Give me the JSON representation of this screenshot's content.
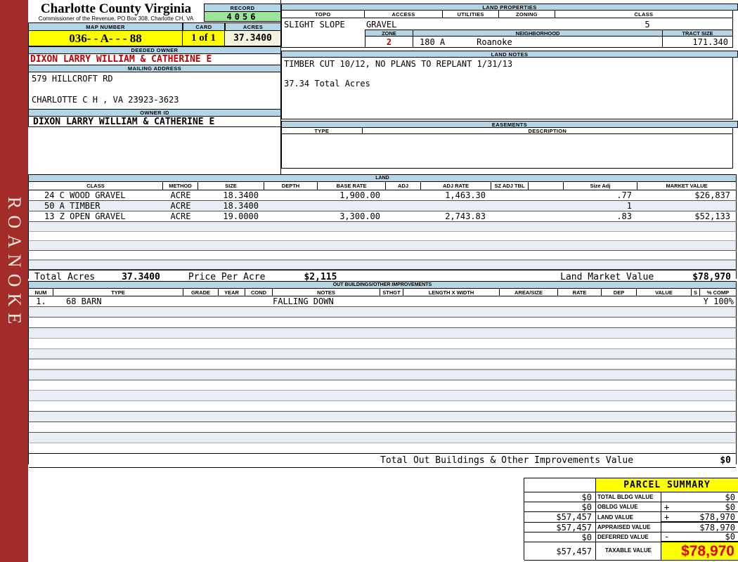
{
  "sidebar": {
    "label": "ROANOKE"
  },
  "header": {
    "county": "Charlotte County Virginia",
    "commissioner": "Commissioner of the Revenue, PO Box 308, Charlotte CH, VA",
    "record_label": "RECORD",
    "record_value": "4056",
    "map_label": "MAP NUMBER",
    "map_value": "036- - A- - - 88",
    "card_label": "CARD",
    "card_value": "1 of 1",
    "acres_label": "ACRES",
    "acres_value": "37.3400"
  },
  "owner": {
    "deeded_label": "DEEDED OWNER",
    "deeded_value": "DIXON LARRY WILLIAM & CATHERINE E",
    "mailing_label": "MAILING ADDRESS",
    "address_line1": "579 HILLCROFT RD",
    "address_line2": "CHARLOTTE C H , VA 23923-3623",
    "owner_id_label": "OWNER ID",
    "owner_id_value": "DIXON LARRY WILLIAM & CATHERINE E"
  },
  "land_properties": {
    "title": "LAND PROPERTIES",
    "headers": {
      "topo": "TOPO",
      "access": "ACCESS",
      "utilities": "UTILITIES",
      "zoning": "ZONING",
      "class": "CLASS"
    },
    "values": {
      "topo": "SLIGHT SLOPE",
      "access": "GRAVEL",
      "class": "5"
    },
    "zone_label": "ZONE",
    "zone_value": "2",
    "neighborhood_label": "NEIGHBORHOOD",
    "neighborhood_code": "180 A",
    "neighborhood_name": "Roanoke",
    "tract_label": "TRACT SIZE",
    "tract_value": "171.340"
  },
  "land_notes": {
    "title": "LAND NOTES",
    "line1": "TIMBER CUT 10/12, NO PLANS TO REPLANT 1/31/13",
    "line2": "37.34 Total Acres"
  },
  "easements": {
    "title": "EASEMENTS",
    "type_label": "TYPE",
    "description_label": "DESCRIPTION"
  },
  "land": {
    "title": "LAND",
    "headers": [
      "CLASS",
      "METHOD",
      "SIZE",
      "DEPTH",
      "BASE RATE",
      "ADJ",
      "ADJ RATE",
      "SZ ADJ TBL",
      "",
      "Size Adj",
      "MARKET VALUE"
    ],
    "rows": [
      {
        "class": "24 C WOOD GRAVEL",
        "method": "ACRE",
        "size": "18.3400",
        "depth": "",
        "base_rate": "1,900.00",
        "adj": "",
        "adj_rate": "1,463.30",
        "sz_adj_tbl": "",
        "extra": "",
        "size_adj": ".77",
        "market_value": "$26,837"
      },
      {
        "class": "50 A TIMBER",
        "method": "ACRE",
        "size": "18.3400",
        "depth": "",
        "base_rate": "",
        "adj": "",
        "adj_rate": "",
        "sz_adj_tbl": "",
        "extra": "",
        "size_adj": "1",
        "market_value": ""
      },
      {
        "class": "13 Z OPEN GRAVEL",
        "method": "ACRE",
        "size": "19.0000",
        "depth": "",
        "base_rate": "3,300.00",
        "adj": "",
        "adj_rate": "2,743.83",
        "sz_adj_tbl": "",
        "extra": "",
        "size_adj": ".83",
        "market_value": "$52,133"
      }
    ],
    "total_acres_label": "Total Acres",
    "total_acres_value": "37.3400",
    "price_per_acre_label": "Price Per Acre",
    "price_per_acre_value": "$2,115",
    "market_value_label": "Land Market Value",
    "market_value_total": "$78,970"
  },
  "out_buildings": {
    "title": "OUT BUILDINGS/OTHER IMPROVEMENTS",
    "headers": [
      "NUM",
      "TYPE",
      "GRADE",
      "YEAR",
      "COND",
      "NOTES",
      "STHGT",
      "LENGTH X WIDTH",
      "AREA/SIZE",
      "RATE",
      "DEP",
      "VALUE",
      "S",
      "% COMP"
    ],
    "rows": [
      {
        "num": "1.",
        "type": "68 BARN",
        "grade": "",
        "year": "",
        "cond": "",
        "notes": "FALLING DOWN",
        "sthgt": "",
        "length_width": "",
        "area_size": "",
        "rate": "",
        "dep": "",
        "value": "",
        "s_comp": "Y 100%"
      }
    ],
    "total_label": "Total Out Buildings & Other Improvements Value",
    "total_value": "$0"
  },
  "parcel_summary": {
    "title": "PARCEL SUMMARY",
    "rows": [
      {
        "left": "$0",
        "label": "TOTAL BLDG VALUE",
        "op": "",
        "value": "$0"
      },
      {
        "left": "$0",
        "label": "OBLDG VALUE",
        "op": "+",
        "value": "$0"
      },
      {
        "left": "$57,457",
        "label": "LAND VALUE",
        "op": "+",
        "value": "$78,970"
      },
      {
        "left": "$57,457",
        "label": "APPRAISED VALUE",
        "op": "",
        "value": "$78,970"
      },
      {
        "left": "$0",
        "label": "DEFERRED VALUE",
        "op": "-",
        "value": "$0"
      }
    ],
    "taxable": {
      "left": "$57,457",
      "label": "TAXABLE VALUE",
      "value": "$78,970"
    }
  },
  "colors": {
    "accent_blue": "#B3D6E6",
    "record_green": "#99E699",
    "highlight_yellow": "#FFFF00",
    "sidebar_red": "#A32C28",
    "alert_red": "#C00000"
  }
}
